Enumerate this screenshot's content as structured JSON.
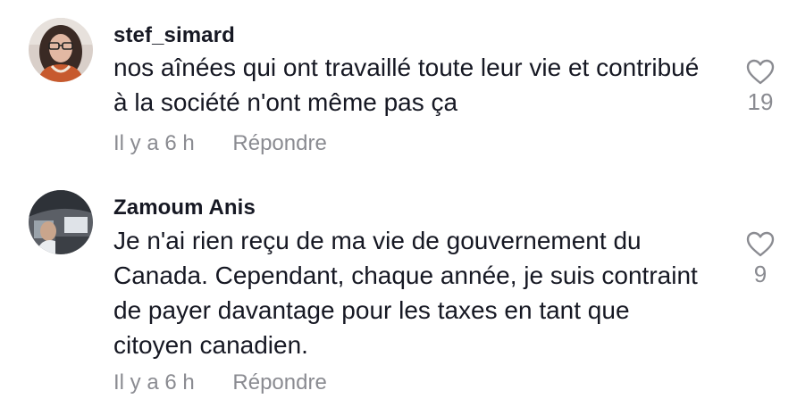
{
  "comments": [
    {
      "username": "stef_simard",
      "text": "nos aînées qui ont travaillé toute leur vie et contribué à la société n'ont même pas ça",
      "time": "Il y a 6 h",
      "reply_label": "Répondre",
      "like_count": "19",
      "like_icon": "heart-outline-icon"
    },
    {
      "username": "Zamoum Anis",
      "text": "Je n'ai rien reçu de ma vie de gouvernement du Canada. Cependant, chaque année, je suis contraint de payer davantage pour les taxes en tant que citoyen canadien.",
      "time": "Il y a 6 h",
      "reply_label": "Répondre",
      "like_count": "9",
      "like_icon": "heart-outline-icon"
    }
  ],
  "colors": {
    "text_primary": "#161823",
    "text_secondary": "#8a8b91"
  }
}
